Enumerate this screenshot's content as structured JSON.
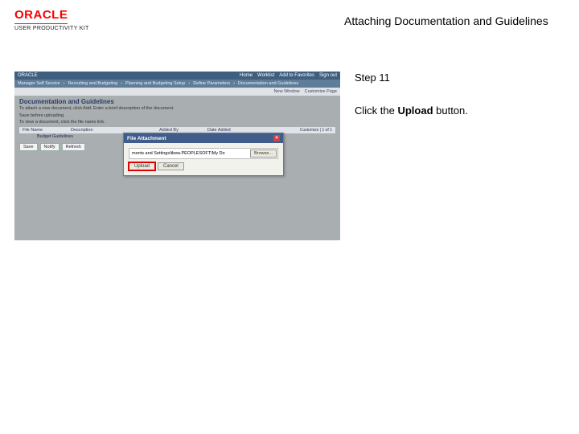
{
  "header": {
    "logo_text": "ORACLE",
    "upk_text": "USER PRODUCTIVITY KIT",
    "title": "Attaching Documentation and Guidelines"
  },
  "instructions": {
    "step_label": "Step 11",
    "line_prefix": "Click the ",
    "button_name": "Upload",
    "line_suffix": " button."
  },
  "app": {
    "brand": "ORACLE",
    "top_right": [
      "Home",
      "Worklist",
      "Add to Favorites",
      "Sign out"
    ],
    "menu": [
      "Manager Self Service",
      "Recruiting and Budgeting",
      "Planning and Budgeting Setup",
      "Define Parameters",
      "Documentation and Guidelines"
    ],
    "sub_right": [
      "New Window",
      "Customize Page"
    ],
    "page_title": "Documentation and Guidelines",
    "desc1": "To attach a new document, click Add. Enter a brief description of the document.",
    "desc2": "Save before uploading.",
    "desc3": "To view a document, click the file name link.",
    "grid": {
      "c1": "File Name",
      "c2": "Description",
      "c3": "Added By",
      "c4": "Date Added",
      "right": "Customize | 1 of 1"
    },
    "row_label": "Budget Guidelines",
    "buttons": [
      "Save",
      "Notify",
      "Refresh"
    ]
  },
  "modal": {
    "title": "File Attachment",
    "file_value": "ments and Settings\\tbew.PEOPLESOFT\\My Do",
    "browse": "Browse...",
    "upload": "Upload",
    "cancel": "Cancel"
  }
}
